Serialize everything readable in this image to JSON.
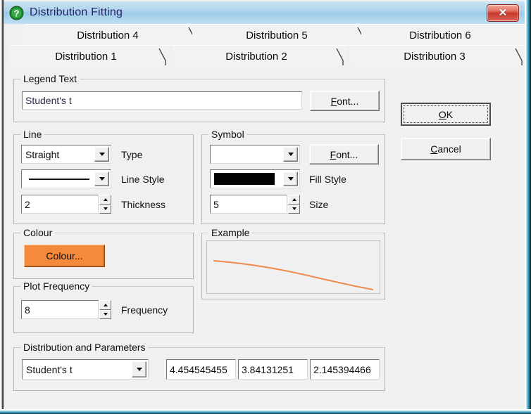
{
  "window": {
    "title": "Distribution Fitting",
    "icon": "question-mark-icon",
    "close_label": "✕"
  },
  "tabs": {
    "top_row": [
      {
        "label": "Distribution 4",
        "active": false
      },
      {
        "label": "Distribution 5",
        "active": false
      },
      {
        "label": "Distribution 6",
        "active": false
      }
    ],
    "bottom_row": [
      {
        "label": "Distribution 1",
        "active": true
      },
      {
        "label": "Distribution 2",
        "active": false
      },
      {
        "label": "Distribution 3",
        "active": false
      }
    ]
  },
  "legend_text": {
    "group_title": "Legend Text",
    "value": "Student's t",
    "placeholder": "",
    "font_button": "Font..."
  },
  "line": {
    "group_title": "Line",
    "type_value": "Straight",
    "type_label": "Type",
    "line_style_value": "solid-line",
    "line_style_label": "Line Style",
    "thickness_value": "2",
    "thickness_label": "Thickness"
  },
  "symbol": {
    "group_title": "Symbol",
    "symbol_value": "",
    "font_button": "Font...",
    "fill_style_value": "solid-black",
    "fill_style_label": "Fill Style",
    "size_value": "5",
    "size_label": "Size"
  },
  "colour": {
    "group_title": "Colour",
    "button_label": "Colour...",
    "swatch_hex": "#f58a3c"
  },
  "plot_frequency": {
    "group_title": "Plot Frequency",
    "value": "8",
    "label": "Frequency"
  },
  "example": {
    "group_title": "Example",
    "line_colour": "#f08a4b"
  },
  "distribution_parameters": {
    "group_title": "Distribution and Parameters",
    "distribution_value": "Student's t",
    "params": [
      "4.454545455",
      "3.84131251",
      "2.145394466"
    ]
  },
  "actions": {
    "ok_label": "OK",
    "ok_accel": "O",
    "cancel_label": "Cancel",
    "cancel_accel": "C"
  }
}
